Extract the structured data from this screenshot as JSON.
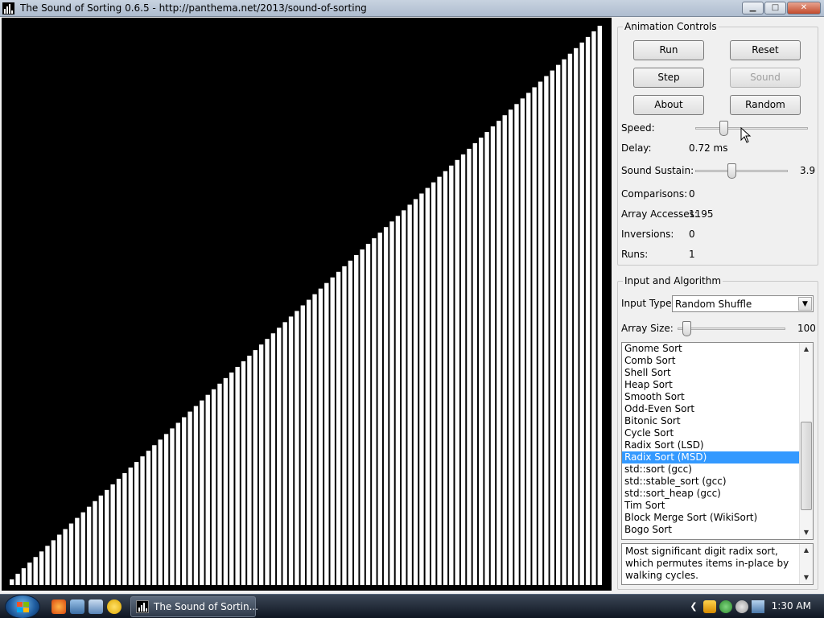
{
  "window": {
    "title": "The Sound of Sorting 0.6.5 - http://panthema.net/2013/sound-of-sorting",
    "minimize": "▁",
    "maximize": "□",
    "close": "✕"
  },
  "visualization": {
    "array_size": 100,
    "bar_color": "#ffffff",
    "background": "#000000",
    "state": "sorted ascending"
  },
  "animation_controls": {
    "legend": "Animation Controls",
    "run": "Run",
    "reset": "Reset",
    "step": "Step",
    "sound": "Sound",
    "about": "About",
    "random": "Random",
    "speed_label": "Speed:",
    "speed_position": 0.23,
    "delay_label": "Delay:",
    "delay_value": "0.72 ms",
    "sustain_label": "Sound Sustain:",
    "sustain_position": 0.38,
    "sustain_value": "3.9",
    "comparisons_label": "Comparisons:",
    "comparisons_value": "0",
    "accesses_label": "Array Accesses:",
    "accesses_value": "1195",
    "inversions_label": "Inversions:",
    "inversions_value": "0",
    "runs_label": "Runs:",
    "runs_value": "1"
  },
  "input_algorithm": {
    "legend": "Input and Algorithm",
    "input_type_label": "Input Type:",
    "input_type_value": "Random Shuffle",
    "array_size_label": "Array Size:",
    "array_size_position": 0.05,
    "array_size_value": "100",
    "algorithms": [
      "Gnome Sort",
      "Comb Sort",
      "Shell Sort",
      "Heap Sort",
      "Smooth Sort",
      "Odd-Even Sort",
      "Bitonic Sort",
      "Cycle Sort",
      "Radix Sort (LSD)",
      "Radix Sort (MSD)",
      "std::sort (gcc)",
      "std::stable_sort (gcc)",
      "std::sort_heap (gcc)",
      "Tim Sort",
      "Block Merge Sort (WikiSort)",
      "Bogo Sort"
    ],
    "selected_index": 9,
    "description": "Most significant digit radix sort, which permutes items in-place by walking cycles."
  },
  "taskbar": {
    "task_label": "The Sound of Sortin...",
    "clock": "1:30 AM"
  },
  "colors": {
    "selection": "#3399ff",
    "window_bg": "#f0f0f0",
    "taskbar": "#1c2533"
  }
}
